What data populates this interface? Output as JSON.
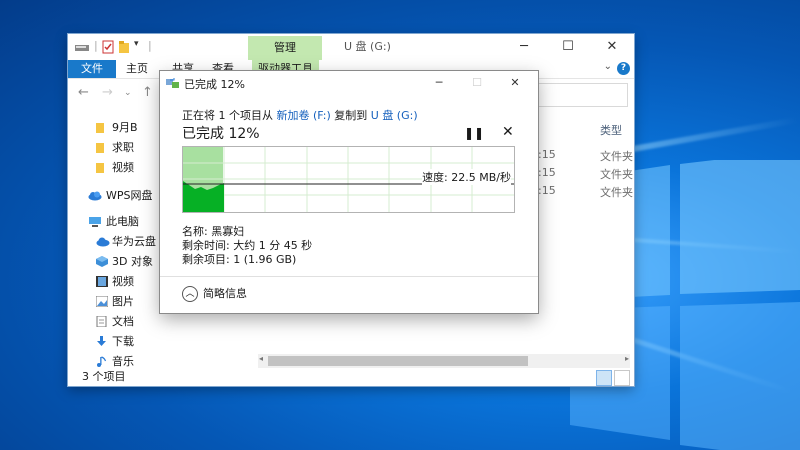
{
  "explorer": {
    "ribbon_tab_manage": "管理",
    "window_title": "U 盘 (G:)",
    "ribbon": {
      "file": "文件",
      "home": "主页",
      "share": "共享",
      "view": "查看",
      "drive_tools": "驱动器工具"
    },
    "sidebar": [
      {
        "label": "9月B",
        "icon": "folder-icon"
      },
      {
        "label": "求职",
        "icon": "folder-icon"
      },
      {
        "label": "视频",
        "icon": "folder-icon"
      },
      {
        "label": "WPS网盘",
        "icon": "cloud-icon"
      },
      {
        "label": "此电脑",
        "icon": "computer-icon"
      },
      {
        "label": "华为云盘",
        "icon": "cloud-icon"
      },
      {
        "label": "3D 对象",
        "icon": "cube-icon"
      },
      {
        "label": "视频",
        "icon": "video-icon"
      },
      {
        "label": "图片",
        "icon": "picture-icon"
      },
      {
        "label": "文档",
        "icon": "document-icon"
      },
      {
        "label": "下载",
        "icon": "download-icon"
      },
      {
        "label": "音乐",
        "icon": "music-icon"
      }
    ],
    "columns": {
      "type": "类型"
    },
    "rows": [
      {
        "date_fragment": ":15",
        "type": "文件夹"
      },
      {
        "date_fragment": ":15",
        "type": "文件夹"
      },
      {
        "date_fragment": ":15",
        "type": "文件夹"
      }
    ],
    "status": "3 个项目",
    "help_glyph": "?"
  },
  "copy_dialog": {
    "title": "已完成 12%",
    "source_line": {
      "prefix": "正在将 1 个项目从 ",
      "source": "新加卷 (F:)",
      "middle": " 复制到 ",
      "dest": "U 盘 (G:)"
    },
    "progress_text": "已完成 12%",
    "progress_fraction": 0.12,
    "speed": "速度: 22.5 MB/秒",
    "name": "名称: 黑寡妇",
    "time_remaining": "剩余时间: 大约 1 分 45 秒",
    "items_remaining": "剩余项目: 1 (1.96 GB)",
    "details_toggle": "简略信息"
  },
  "colors": {
    "accent": "#1979ca",
    "ribbon_context": "#c3e8b0",
    "progress_fill": "#a8e0a0",
    "graph_fill": "#06b025"
  }
}
